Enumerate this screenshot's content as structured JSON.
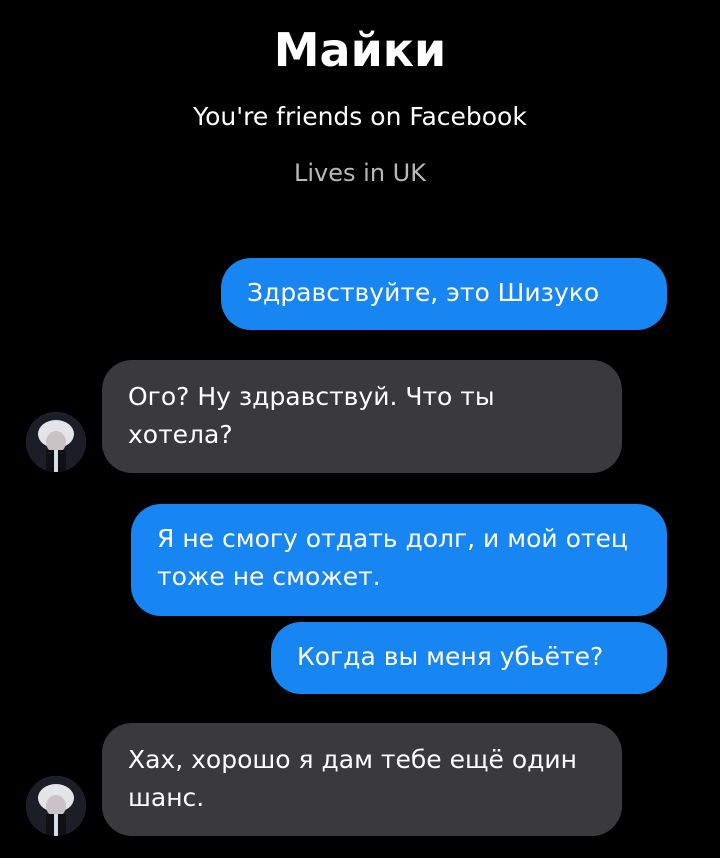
{
  "header": {
    "contact_name": "Майки",
    "friends_text": "You're friends on Facebook",
    "location_text": "Lives in UK"
  },
  "messages": [
    {
      "direction": "outgoing",
      "text": "Здравствуйте, это Шизуко"
    },
    {
      "direction": "incoming",
      "text": "Ого? Ну здравствуй. Что ты хотела?"
    },
    {
      "direction": "outgoing",
      "text": "Я не смогу отдать долг, и мой отец тоже не сможет."
    },
    {
      "direction": "outgoing",
      "text": "Когда вы меня убьёте?"
    },
    {
      "direction": "incoming",
      "text": "Хах, хорошо я дам тебе ещё один шанс."
    }
  ],
  "colors": {
    "background": "#000000",
    "outgoing_bubble": "#1785f2",
    "incoming_bubble": "#3a3a3c",
    "secondary_text": "#b9b9b9"
  },
  "icons": {
    "avatar": "contact-avatar"
  }
}
